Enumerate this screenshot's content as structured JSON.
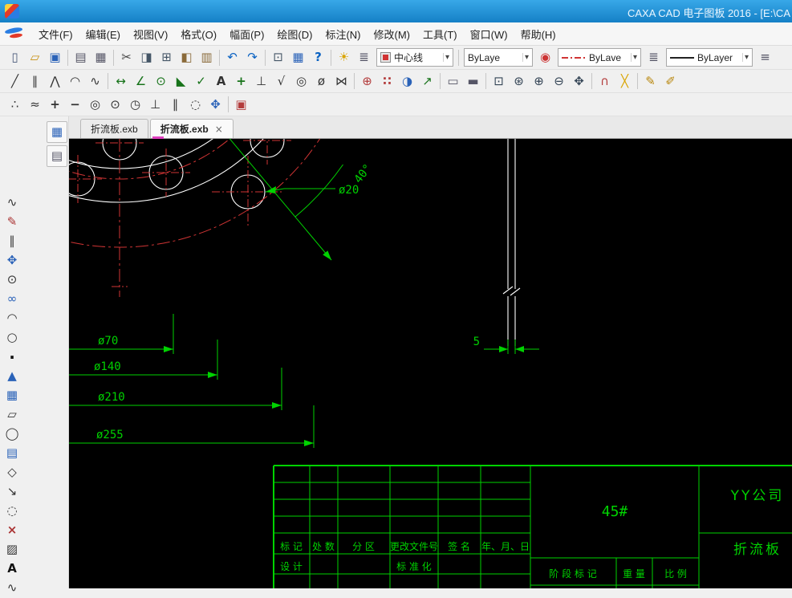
{
  "titlebar": {
    "title": "CAXA CAD 电子图板 2016 - [E:\\CA"
  },
  "menubar": {
    "items": [
      "文件(F)",
      "编辑(E)",
      "视图(V)",
      "格式(O)",
      "幅面(P)",
      "绘图(D)",
      "标注(N)",
      "修改(M)",
      "工具(T)",
      "窗口(W)",
      "帮助(H)"
    ]
  },
  "toolbar_top": {
    "icons_a": [
      "new",
      "open",
      "save",
      "sep",
      "plot",
      "print",
      "sep",
      "cut",
      "copy",
      "copy-base",
      "paste",
      "paste-special",
      "sep",
      "undo",
      "redo",
      "sep",
      "ole",
      "table",
      "help",
      "sep",
      "bulb",
      "layers"
    ],
    "layer_combo": {
      "value": "中心线"
    },
    "color_combo": {
      "value": "ByLaye"
    },
    "icons_b": [
      "colorwheel"
    ],
    "linetype_combo": {
      "value": "ByLave"
    },
    "icons_c": [
      "linetype-mgr"
    ],
    "linewidth_combo": {
      "value": "ByLayer"
    },
    "icons_d": [
      "width-mgr"
    ]
  },
  "toolbar_draw": {
    "icons": [
      "line",
      "parallel",
      "polyline",
      "arc",
      "spline",
      "sep",
      "dim-linear",
      "dim-angular",
      "dim-radial",
      "dim-chamfer",
      "dim-check",
      "text",
      "dim-coord",
      "datum",
      "roughness",
      "balloon",
      "tolerance",
      "weld",
      "sep",
      "center-hole",
      "grid-dots",
      "sphere",
      "leader",
      "sep",
      "paper-frame",
      "title-bar",
      "sep",
      "zoom-window",
      "zoom-all",
      "zoom-in",
      "zoom-out",
      "pan",
      "sep",
      "snap",
      "cross-guide",
      "sep",
      "pen",
      "brush"
    ]
  },
  "toolbar_snap": {
    "icons": [
      "point-style",
      "jog",
      "cross-point",
      "dash-point",
      "target",
      "circle-point",
      "clock",
      "perpendicular",
      "parallel-snap",
      "lasso",
      "move-point",
      "sep",
      "stamp"
    ]
  },
  "dock": {
    "icons": [
      "sheet-grid",
      "sheet-order"
    ]
  },
  "toolbar_left": {
    "icons": [
      "spline-pen",
      "brush2",
      "parallel-draw",
      "move-tool",
      "circle-center",
      "link-circles",
      "arc-draw",
      "circle-small",
      "point-draw",
      "triangle",
      "grid-array",
      "rect-fold",
      "ellipse-draw",
      "panel",
      "polygon",
      "arrow-line",
      "ellipse-dash",
      "cross-mark",
      "hatch",
      "text-a",
      "wave"
    ]
  },
  "tabs": {
    "items": [
      {
        "label": "折流板.exb"
      },
      {
        "label": "折流板.exb",
        "close": "×"
      }
    ]
  },
  "canvas": {
    "dimensions": {
      "hole": "ø20",
      "angle": "40°",
      "d70": "ø70",
      "d140": "ø140",
      "d210": "ø210",
      "d255": "ø255",
      "thickness": "5"
    },
    "colors": {
      "background": "#000000",
      "geometry": "#ffffff",
      "centerline": "#d03434",
      "dimension": "#00d200"
    }
  },
  "titleblock": {
    "material": "45#",
    "company": "YY公司",
    "part": "折流板",
    "headers": [
      "标 记",
      "处 数",
      "分 区",
      "更改文件号",
      "签 名",
      "年、月、日"
    ],
    "design_label": "设 计",
    "standard_label": "标 准 化",
    "stage_label": "阶 段 标 记",
    "weight_label": "重 量",
    "scale_label": "比 例"
  }
}
